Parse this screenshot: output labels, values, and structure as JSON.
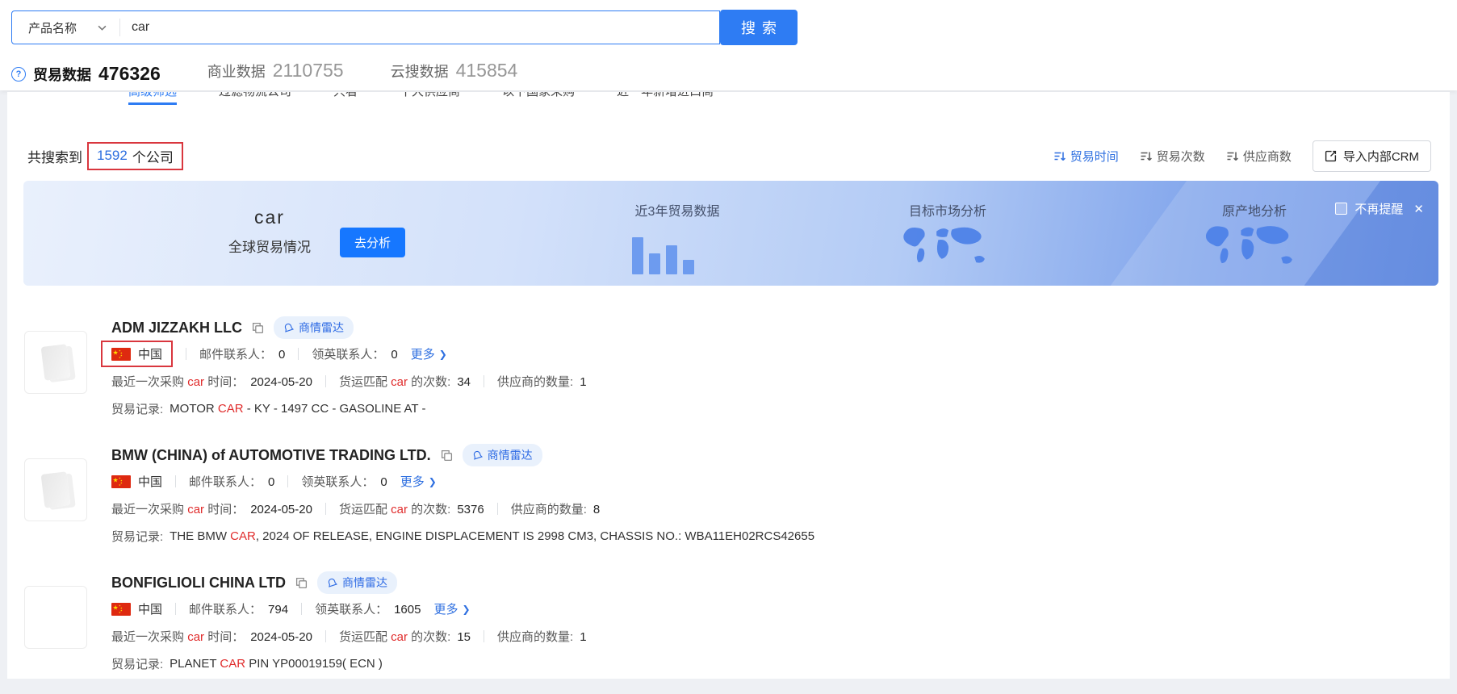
{
  "header": {
    "search": {
      "category_label": "产品名称",
      "query": "car",
      "button_label": "搜索"
    },
    "tabs": [
      {
        "label": "贸易数据",
        "count": "476326"
      },
      {
        "label": "商业数据",
        "count": "2110755"
      },
      {
        "label": "云搜数据",
        "count": "415854"
      }
    ]
  },
  "filters": {
    "items": [
      "高级筛选",
      "过滤物流公司",
      "只看",
      "十大供应商",
      "以下国家采购",
      "近一年新增进口商"
    ]
  },
  "results": {
    "summary_prefix": "共搜索到",
    "summary_count": "1592",
    "summary_suffix": "个公司",
    "sorts": [
      {
        "label": "贸易时间"
      },
      {
        "label": "贸易次数"
      },
      {
        "label": "供应商数"
      }
    ],
    "crm_button": "导入内部CRM"
  },
  "banner": {
    "keyword": "car",
    "subtitle": "全球贸易情况",
    "analyze_button": "去分析",
    "section_trade": "近3年贸易数据",
    "section_market": "目标市场分析",
    "section_origin": "原产地分析",
    "dismiss_label": "不再提醒",
    "close_icon": "✕",
    "bars": [
      46,
      26,
      36,
      18
    ]
  },
  "companies": [
    {
      "name": "ADM JIZZAKH LLC",
      "badge": "商情雷达",
      "country": "中国",
      "email_label": "邮件联系人：",
      "email_count": "0",
      "linkedin_label": "领英联系人：",
      "linkedin_count": "0",
      "more_label": "更多",
      "purchase_pre": "最近一次采购",
      "purchase_kw": "car",
      "purchase_mid": "时间：",
      "purchase_date": "2024-05-20",
      "freight_pre": "货运匹配",
      "freight_kw": "car",
      "freight_mid": "的次数:",
      "freight_count": "34",
      "supplier_label": "供应商的数量:",
      "supplier_count": "1",
      "record_label": "贸易记录:",
      "record_pre": "MOTOR ",
      "record_kw": "CAR",
      "record_post": " - KY - 1497 CC - GASOLINE AT -"
    },
    {
      "name": "BMW (CHINA) of AUTOMOTIVE TRADING LTD.",
      "badge": "商情雷达",
      "country": "中国",
      "email_label": "邮件联系人：",
      "email_count": "0",
      "linkedin_label": "领英联系人：",
      "linkedin_count": "0",
      "more_label": "更多",
      "purchase_pre": "最近一次采购",
      "purchase_kw": "car",
      "purchase_mid": "时间：",
      "purchase_date": "2024-05-20",
      "freight_pre": "货运匹配",
      "freight_kw": "car",
      "freight_mid": "的次数:",
      "freight_count": "5376",
      "supplier_label": "供应商的数量:",
      "supplier_count": "8",
      "record_label": "贸易记录:",
      "record_pre": "THE BMW ",
      "record_kw": "CAR",
      "record_post": ", 2024 OF RELEASE, ENGINE DISPLACEMENT IS 2998 CM3, CHASSIS NO.: WBA11EH02RCS42655"
    },
    {
      "name": "BONFIGLIOLI CHINA LTD",
      "badge": "商情雷达",
      "country": "中国",
      "email_label": "邮件联系人：",
      "email_count": "794",
      "linkedin_label": "领英联系人：",
      "linkedin_count": "1605",
      "more_label": "更多",
      "purchase_pre": "最近一次采购",
      "purchase_kw": "car",
      "purchase_mid": "时间：",
      "purchase_date": "2024-05-20",
      "freight_pre": "货运匹配",
      "freight_kw": "car",
      "freight_mid": "的次数:",
      "freight_count": "15",
      "supplier_label": "供应商的数量:",
      "supplier_count": "1",
      "record_label": "贸易记录:",
      "record_pre": "PLANET ",
      "record_kw": "CAR",
      "record_post": " PIN YP00019159( ECN )"
    }
  ],
  "ui": {
    "chevron_right": "❯",
    "question_mark": "?"
  }
}
